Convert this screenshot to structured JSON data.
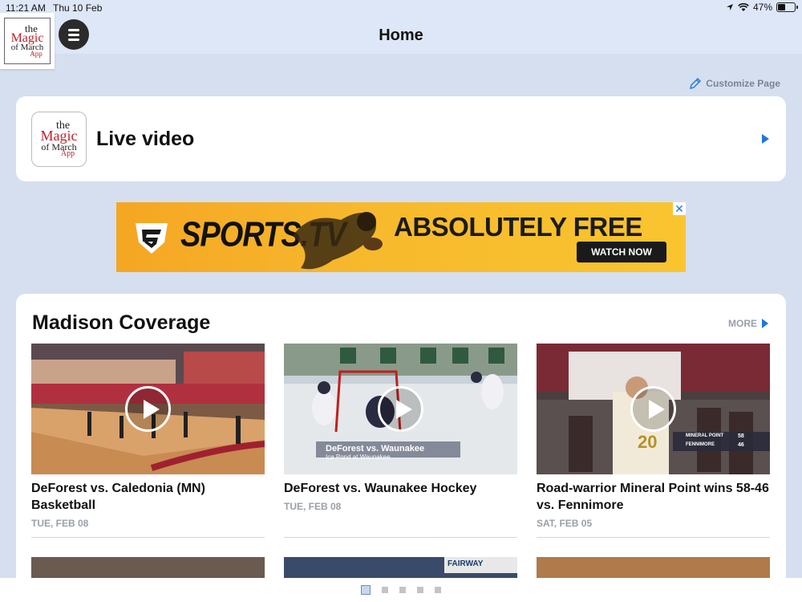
{
  "status_bar": {
    "time": "11:21 AM",
    "date": "Thu 10 Feb",
    "battery_percent": "47%",
    "battery_level": 0.47
  },
  "nav": {
    "title": "Home",
    "logo_text": [
      "the",
      "Magic",
      "of March",
      "App"
    ]
  },
  "customize_label": "Customize Page",
  "live_card": {
    "title": "Live video",
    "logo_text": [
      "the",
      "Magic",
      "of March",
      "App"
    ]
  },
  "ad": {
    "brand": "SPORTS.TV",
    "headline": "ABSOLUTELY FREE",
    "cta": "WATCH NOW",
    "close": "✕"
  },
  "coverage": {
    "title": "Madison Coverage",
    "more": "MORE",
    "videos": [
      {
        "title": "DeForest vs. Caledonia (MN) Basketball",
        "date": "TUE, FEB 08"
      },
      {
        "title": "DeForest vs. Waunakee Hockey",
        "date": "TUE, FEB 08",
        "overlay_title": "DeForest vs. Waunakee",
        "overlay_sub": "Ice Pond at Waunakee"
      },
      {
        "title": "Road-warrior Mineral Point wins 58-46 vs. Fennimore",
        "date": "SAT, FEB 05",
        "score_team1": "MINERAL POINT",
        "score1": "58",
        "score_team2": "FENNIMORE",
        "score2": "46",
        "jersey": "20"
      }
    ],
    "next_row_sign": "FAIRWAY"
  },
  "pagination": {
    "count": 5,
    "active": 1
  },
  "colors": {
    "accent": "#1b78e0",
    "background": "#d5dff0",
    "nav": "#dde7f7",
    "ad_yellow": "#f7b92d"
  }
}
